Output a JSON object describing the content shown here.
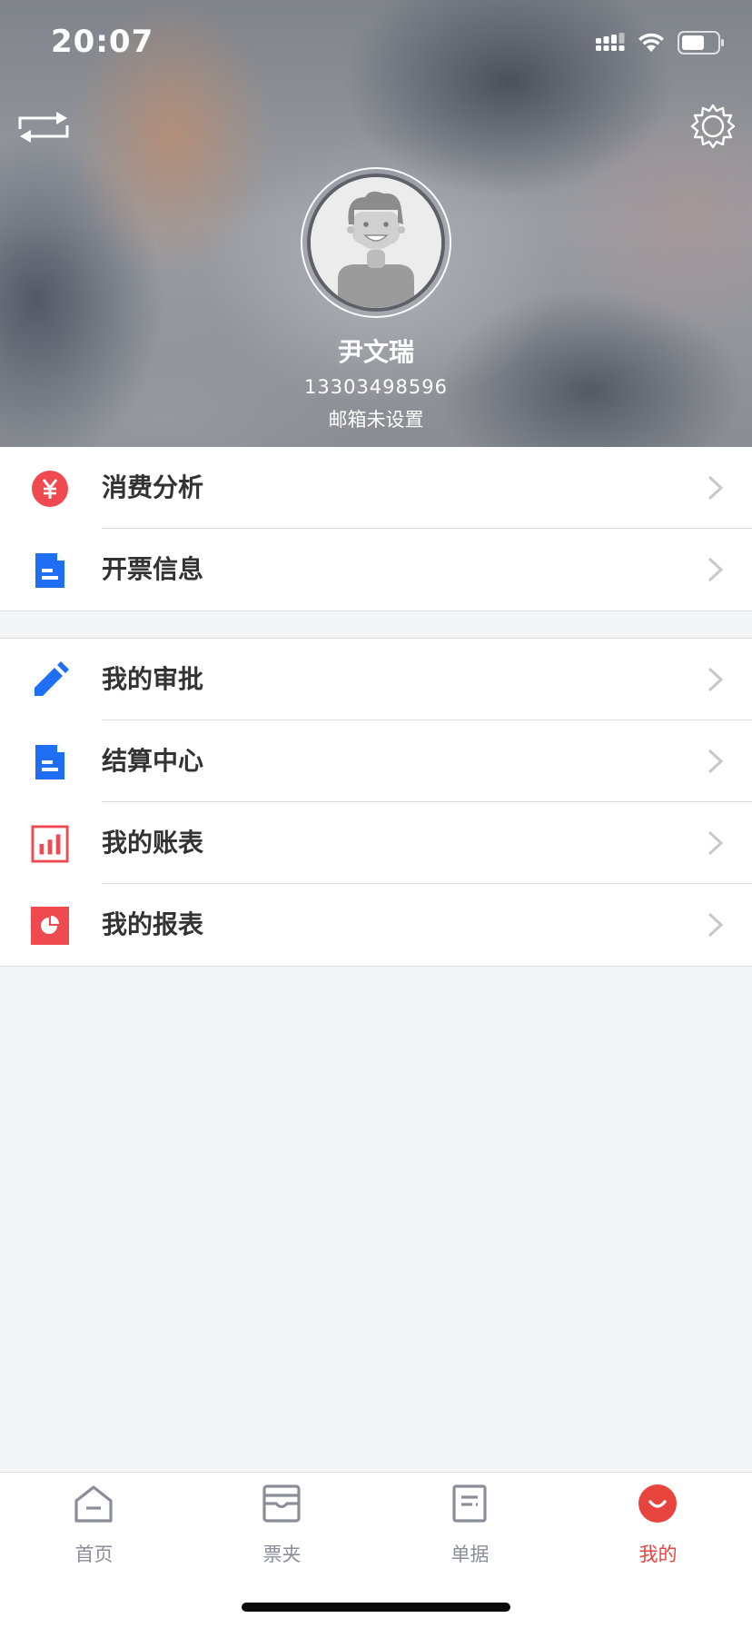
{
  "status_bar": {
    "time": "20:07"
  },
  "header": {
    "swap_icon": "swap-arrows-icon",
    "settings_icon": "gear-icon",
    "avatar_icon": "default-user-avatar",
    "name": "尹文瑞",
    "phone": "13303498596",
    "email": "邮箱未设置"
  },
  "menu_group_1": [
    {
      "label": "消费分析",
      "icon": "yen-circle-icon",
      "color": "#ef4a4f"
    },
    {
      "label": "开票信息",
      "icon": "document-icon",
      "color": "#1f6ff5"
    }
  ],
  "menu_group_2": [
    {
      "label": "我的审批",
      "icon": "pencil-icon",
      "color": "#1f6ff5"
    },
    {
      "label": "结算中心",
      "icon": "document-icon",
      "color": "#1f6ff5"
    },
    {
      "label": "我的账表",
      "icon": "bar-chart-icon",
      "color": "#ef4a4f"
    },
    {
      "label": "我的报表",
      "icon": "pie-chart-icon",
      "color": "#ef4a4f"
    }
  ],
  "tab_bar": {
    "tabs": [
      {
        "label": "首页",
        "icon": "home-icon",
        "active": false
      },
      {
        "label": "票夹",
        "icon": "ticket-folder-icon",
        "active": false
      },
      {
        "label": "单据",
        "icon": "receipt-icon",
        "active": false
      },
      {
        "label": "我的",
        "icon": "smile-profile-icon",
        "active": true
      }
    ]
  },
  "colors": {
    "accent_red": "#e8443e",
    "accent_blue": "#1f6ff5",
    "tab_inactive": "#8a8e98"
  }
}
